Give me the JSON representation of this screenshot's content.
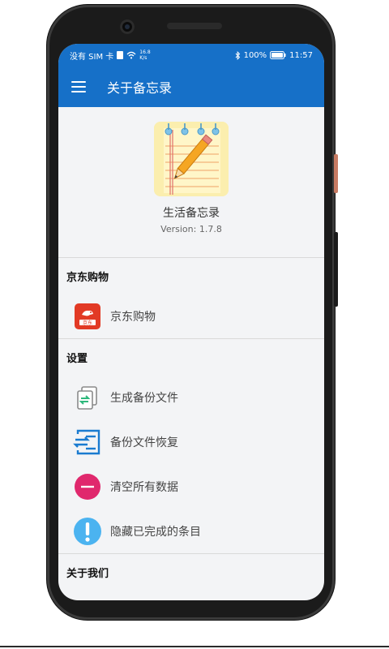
{
  "status": {
    "carrier": "没有 SIM 卡",
    "net_speed_value": "16.8",
    "net_speed_unit": "K/s",
    "battery": "100%",
    "time": "11:57"
  },
  "appbar": {
    "title": "关于备忘录"
  },
  "about": {
    "app_name": "生活备忘录",
    "version": "Version: 1.7.8"
  },
  "sections": [
    {
      "title": "京东购物",
      "items": [
        {
          "label": "京东购物",
          "icon": "jd-icon"
        }
      ]
    },
    {
      "title": "设置",
      "items": [
        {
          "label": "生成备份文件",
          "icon": "backup-file-icon"
        },
        {
          "label": "备份文件恢复",
          "icon": "restore-file-icon"
        },
        {
          "label": "清空所有数据",
          "icon": "clear-data-icon"
        },
        {
          "label": "隐藏已完成的条目",
          "icon": "alert-icon"
        }
      ]
    },
    {
      "title": "关于我们",
      "items": []
    }
  ],
  "colors": {
    "primary": "#1670c8",
    "background": "#f3f4f6",
    "jd_red": "#e23a25",
    "clear_pink": "#e0286d",
    "alert_blue": "#4bb3f0"
  }
}
